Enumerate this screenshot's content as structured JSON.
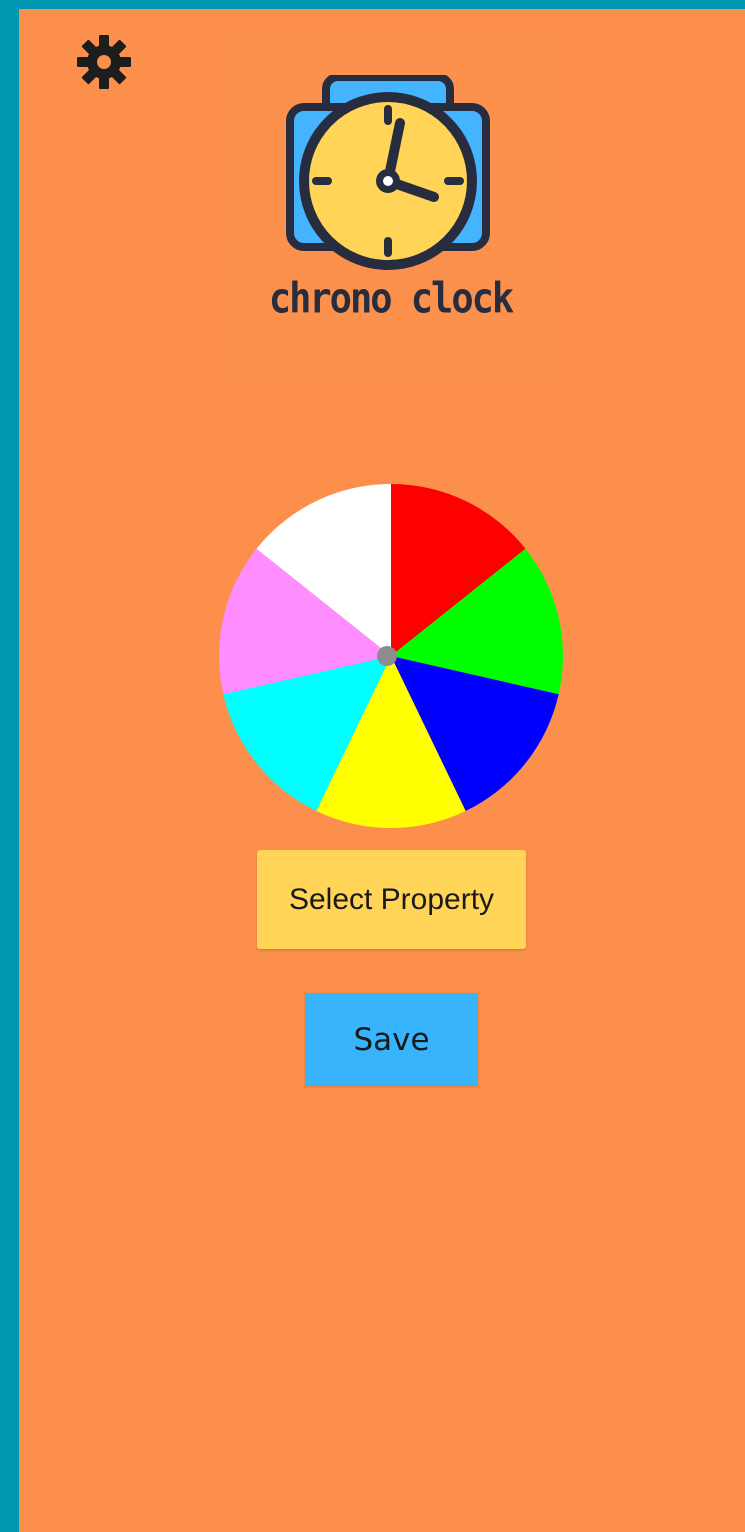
{
  "colors": {
    "frame": "#0097b0",
    "background": "#fb8f4b",
    "select_button": "#ffd457",
    "save_button": "#38b4fd",
    "logo_dark": "#272d3e",
    "logo_face": "#ffd457",
    "logo_camera": "#45b4ff"
  },
  "header": {
    "settings_icon": "gear-icon"
  },
  "logo": {
    "icon": "alarm-clock-camera-icon",
    "title": "chrono clock"
  },
  "color_wheel": {
    "slices": [
      {
        "color": "#ff0000"
      },
      {
        "color": "#00ff00"
      },
      {
        "color": "#0000ff"
      },
      {
        "color": "#ffff00"
      },
      {
        "color": "#00ffff"
      },
      {
        "color": "#ff8dff"
      },
      {
        "color": "#ffffff"
      }
    ],
    "center_color": "#8c8c8c"
  },
  "actions": {
    "select_property_label": "Select Property",
    "save_label": "Save"
  }
}
